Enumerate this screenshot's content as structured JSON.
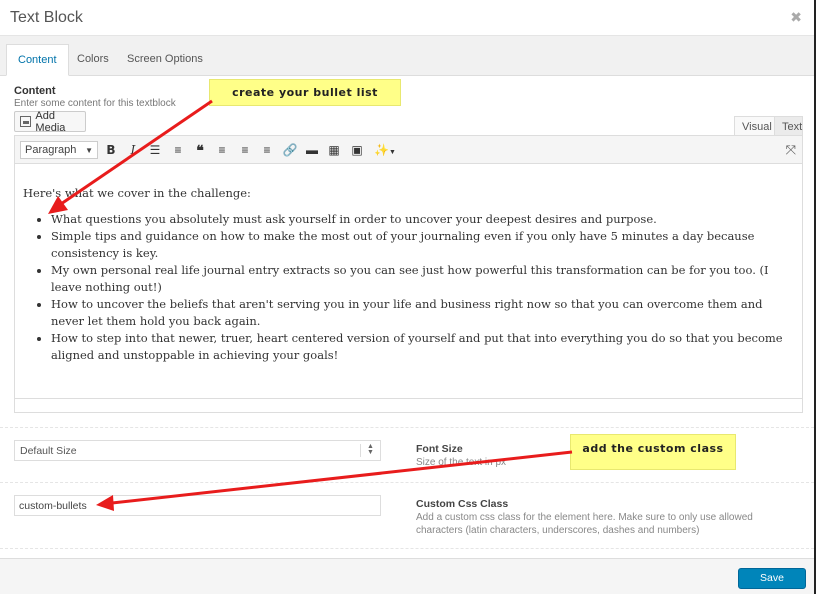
{
  "dialog": {
    "title": "Text Block"
  },
  "tabs": [
    {
      "label": "Content",
      "active": true
    },
    {
      "label": "Colors",
      "active": false
    },
    {
      "label": "Screen Options",
      "active": false
    }
  ],
  "content_field": {
    "label": "Content",
    "description": "Enter some content for this textblock",
    "add_media_label": "Add Media"
  },
  "editor": {
    "mode_tabs": [
      "Visual",
      "Text"
    ],
    "format_select": "Paragraph",
    "intro": "Here's what we cover in the challenge:",
    "bullets": [
      "What questions you absolutely must ask yourself in order to uncover your deepest desires and purpose.",
      "Simple tips and guidance on how to make the most out of your journaling even if you only have 5 minutes a day because consistency is key.",
      "My own personal real life journal entry extracts so you can see just how powerful this transformation can be for you too. (I leave nothing out!)",
      "How to uncover the beliefs that aren't serving you in your life and business right now so that you can overcome them and never let them hold you back again.",
      "How to step into that newer, truer, heart centered version of yourself and put that into everything you do so that you become aligned and unstoppable in achieving your goals!"
    ],
    "toolbar_icons": [
      "bold-icon",
      "italic-icon",
      "bullet-list-icon",
      "numbered-list-icon",
      "blockquote-icon",
      "align-left-icon",
      "align-center-icon",
      "align-right-icon",
      "link-icon",
      "read-more-icon",
      "toolbar-toggle-icon",
      "media-icon",
      "magic-wand-icon",
      "fullscreen-icon"
    ]
  },
  "font_size": {
    "value": "Default Size",
    "title": "Font Size",
    "description": "Size of the text in px"
  },
  "custom_css": {
    "value": "custom-bullets",
    "title": "Custom Css Class",
    "description": "Add a custom css class for the element here. Make sure to only use allowed characters (latin characters, underscores, dashes and numbers)"
  },
  "footer": {
    "save_label": "Save"
  },
  "annotations": {
    "callout_bullets": "create your bullet list",
    "callout_class": "add the custom class",
    "arrow_color": "#e81c1c",
    "callout_color": "#ffff88"
  },
  "colors": {
    "accent": "#0073aa",
    "primary_button": "#0085ba"
  }
}
